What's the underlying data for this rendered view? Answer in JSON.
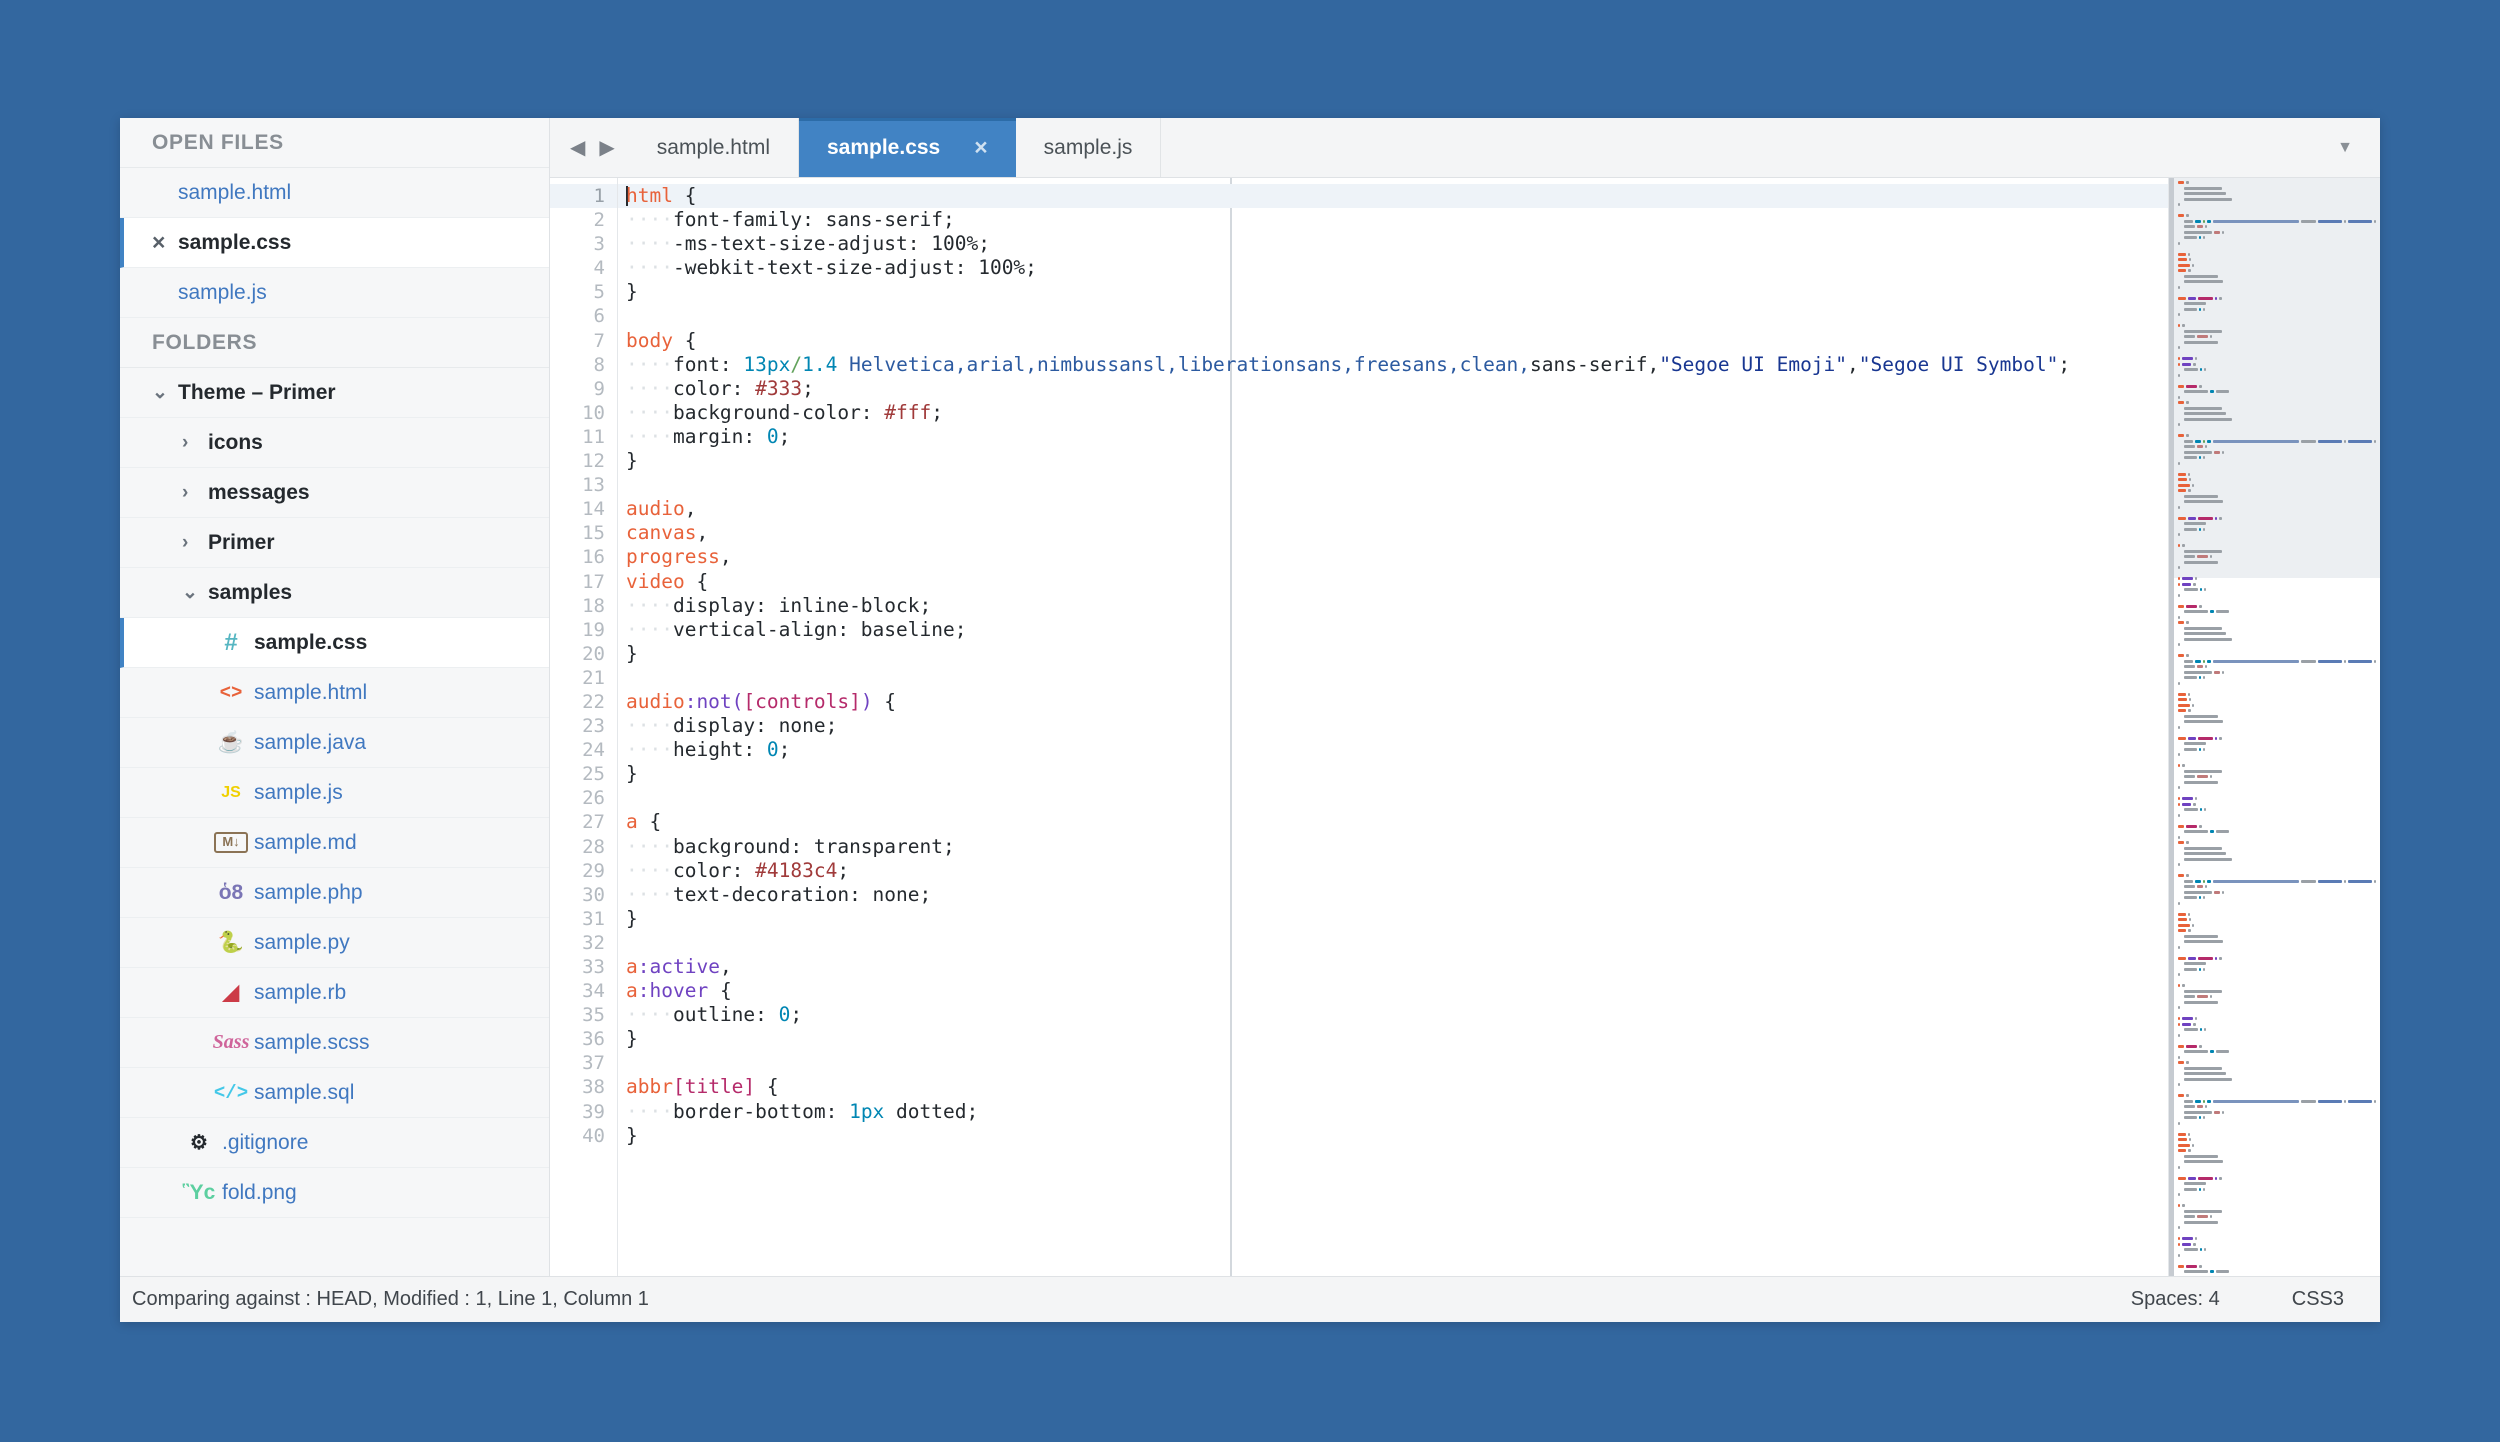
{
  "theme": {
    "desktop_bg": "#33679f",
    "accent": "#4183c4",
    "sidebar_bg": "#f6f7f8",
    "link": "#4078c0"
  },
  "sidebar": {
    "open_files_title": "OPEN FILES",
    "folders_title": "FOLDERS",
    "open_files": [
      {
        "label": "sample.html",
        "selected": false,
        "close_icon": ""
      },
      {
        "label": "sample.css",
        "selected": true,
        "close_icon": "×"
      },
      {
        "label": "sample.js",
        "selected": false,
        "close_icon": ""
      }
    ],
    "tree": [
      {
        "label": "Theme – Primer",
        "type": "folder",
        "twisty": "⌄",
        "expanded": true,
        "indent": 1,
        "icon": ""
      },
      {
        "label": "icons",
        "type": "folder",
        "twisty": "›",
        "expanded": false,
        "indent": 2,
        "icon": ""
      },
      {
        "label": "messages",
        "type": "folder",
        "twisty": "›",
        "expanded": false,
        "indent": 2,
        "icon": ""
      },
      {
        "label": "Primer",
        "type": "folder",
        "twisty": "›",
        "expanded": false,
        "indent": 2,
        "icon": ""
      },
      {
        "label": "samples",
        "type": "folder",
        "twisty": "⌄",
        "expanded": true,
        "indent": 2,
        "icon": ""
      },
      {
        "label": "sample.css",
        "type": "file",
        "indent": 3,
        "icon": "#",
        "icon_name": "css-file-icon",
        "selected": true
      },
      {
        "label": "sample.html",
        "type": "file",
        "indent": 3,
        "icon": "<>",
        "icon_name": "html-file-icon"
      },
      {
        "label": "sample.java",
        "type": "file",
        "indent": 3,
        "icon": "☕",
        "icon_name": "java-file-icon"
      },
      {
        "label": "sample.js",
        "type": "file",
        "indent": 3,
        "icon": "JS",
        "icon_name": "js-file-icon"
      },
      {
        "label": "sample.md",
        "type": "file",
        "indent": 3,
        "icon": "M↓",
        "icon_name": "markdown-file-icon"
      },
      {
        "label": "sample.php",
        "type": "file",
        "indent": 3,
        "icon": "ὁ8",
        "icon_name": "php-file-icon"
      },
      {
        "label": "sample.py",
        "type": "file",
        "indent": 3,
        "icon": "🐍",
        "icon_name": "python-file-icon"
      },
      {
        "label": "sample.rb",
        "type": "file",
        "indent": 3,
        "icon": "◢",
        "icon_name": "ruby-file-icon"
      },
      {
        "label": "sample.scss",
        "type": "file",
        "indent": 3,
        "icon": "Sass",
        "icon_name": "sass-file-icon"
      },
      {
        "label": "sample.sql",
        "type": "file",
        "indent": 3,
        "icon": "</>",
        "icon_name": "sql-file-icon"
      },
      {
        "label": ".gitignore",
        "type": "file",
        "indent": 2,
        "icon": "⚙",
        "icon_name": "gear-icon"
      },
      {
        "label": "fold.png",
        "type": "file",
        "indent": 2,
        "icon": "Ὓc",
        "icon_name": "image-file-icon"
      }
    ]
  },
  "tabbar": {
    "nav_back_icon": "◀",
    "nav_forward_icon": "▶",
    "menu_icon": "▼",
    "tabs": [
      {
        "label": "sample.html",
        "active": false,
        "close": ""
      },
      {
        "label": "sample.css",
        "active": true,
        "close": "×"
      },
      {
        "label": "sample.js",
        "active": false,
        "close": ""
      }
    ]
  },
  "editor": {
    "language": "CSS3",
    "first_line": 1,
    "total_visible_lines": 40,
    "lines": [
      {
        "n": 1,
        "tokens": [
          {
            "t": "caret",
            "v": ""
          },
          {
            "t": "sel",
            "v": "html"
          },
          {
            "t": "punc",
            "v": " {"
          }
        ]
      },
      {
        "n": 2,
        "tokens": [
          {
            "t": "ind",
            "v": "····"
          },
          {
            "t": "prop",
            "v": "font-family: sans-serif;"
          }
        ]
      },
      {
        "n": 3,
        "tokens": [
          {
            "t": "ind",
            "v": "····"
          },
          {
            "t": "prop",
            "v": "-ms-text-size-adjust: 100%;"
          }
        ]
      },
      {
        "n": 4,
        "tokens": [
          {
            "t": "ind",
            "v": "····"
          },
          {
            "t": "prop",
            "v": "-webkit-text-size-adjust: 100%;"
          }
        ]
      },
      {
        "n": 5,
        "tokens": [
          {
            "t": "punc",
            "v": "}"
          }
        ]
      },
      {
        "n": 6,
        "tokens": []
      },
      {
        "n": 7,
        "tokens": [
          {
            "t": "sel",
            "v": "body"
          },
          {
            "t": "punc",
            "v": " {"
          }
        ]
      },
      {
        "n": 8,
        "tokens": [
          {
            "t": "ind",
            "v": "····"
          },
          {
            "t": "prop",
            "v": "font: "
          },
          {
            "t": "num",
            "v": "13px"
          },
          {
            "t": "unit",
            "v": "/"
          },
          {
            "t": "num",
            "v": "1.4"
          },
          {
            "t": "font",
            "v": " Helvetica,arial,nimbussansl,liberationsans,freesans,clean,"
          },
          {
            "t": "prop",
            "v": "sans-serif,"
          },
          {
            "t": "str",
            "v": "\"Segoe UI Emoji\""
          },
          {
            "t": "punc",
            "v": ","
          },
          {
            "t": "str",
            "v": "\"Segoe UI Symbol\""
          },
          {
            "t": "punc",
            "v": ";"
          }
        ]
      },
      {
        "n": 9,
        "tokens": [
          {
            "t": "ind",
            "v": "····"
          },
          {
            "t": "prop",
            "v": "color: "
          },
          {
            "t": "color",
            "v": "#333"
          },
          {
            "t": "punc",
            "v": ";"
          }
        ]
      },
      {
        "n": 10,
        "tokens": [
          {
            "t": "ind",
            "v": "····"
          },
          {
            "t": "prop",
            "v": "background-color: "
          },
          {
            "t": "color",
            "v": "#fff"
          },
          {
            "t": "punc",
            "v": ";"
          }
        ]
      },
      {
        "n": 11,
        "tokens": [
          {
            "t": "ind",
            "v": "····"
          },
          {
            "t": "prop",
            "v": "margin: "
          },
          {
            "t": "num",
            "v": "0"
          },
          {
            "t": "punc",
            "v": ";"
          }
        ]
      },
      {
        "n": 12,
        "tokens": [
          {
            "t": "punc",
            "v": "}"
          }
        ]
      },
      {
        "n": 13,
        "tokens": []
      },
      {
        "n": 14,
        "tokens": [
          {
            "t": "sel",
            "v": "audio"
          },
          {
            "t": "punc",
            "v": ","
          }
        ]
      },
      {
        "n": 15,
        "tokens": [
          {
            "t": "sel",
            "v": "canvas"
          },
          {
            "t": "punc",
            "v": ","
          }
        ]
      },
      {
        "n": 16,
        "tokens": [
          {
            "t": "sel",
            "v": "progress"
          },
          {
            "t": "punc",
            "v": ","
          }
        ]
      },
      {
        "n": 17,
        "tokens": [
          {
            "t": "sel",
            "v": "video"
          },
          {
            "t": "punc",
            "v": " {"
          }
        ]
      },
      {
        "n": 18,
        "tokens": [
          {
            "t": "ind",
            "v": "····"
          },
          {
            "t": "prop",
            "v": "display: inline-block;"
          }
        ]
      },
      {
        "n": 19,
        "tokens": [
          {
            "t": "ind",
            "v": "····"
          },
          {
            "t": "prop",
            "v": "vertical-align: baseline;"
          }
        ]
      },
      {
        "n": 20,
        "tokens": [
          {
            "t": "punc",
            "v": "}"
          }
        ]
      },
      {
        "n": 21,
        "tokens": []
      },
      {
        "n": 22,
        "tokens": [
          {
            "t": "sel",
            "v": "audio"
          },
          {
            "t": "pseudo",
            "v": ":not("
          },
          {
            "t": "attr",
            "v": "[controls]"
          },
          {
            "t": "pseudo",
            "v": ")"
          },
          {
            "t": "punc",
            "v": " {"
          }
        ]
      },
      {
        "n": 23,
        "tokens": [
          {
            "t": "ind",
            "v": "····"
          },
          {
            "t": "prop",
            "v": "display: none;"
          }
        ]
      },
      {
        "n": 24,
        "tokens": [
          {
            "t": "ind",
            "v": "····"
          },
          {
            "t": "prop",
            "v": "height: "
          },
          {
            "t": "num",
            "v": "0"
          },
          {
            "t": "punc",
            "v": ";"
          }
        ]
      },
      {
        "n": 25,
        "tokens": [
          {
            "t": "punc",
            "v": "}"
          }
        ]
      },
      {
        "n": 26,
        "tokens": []
      },
      {
        "n": 27,
        "tokens": [
          {
            "t": "sel",
            "v": "a"
          },
          {
            "t": "punc",
            "v": " {"
          }
        ]
      },
      {
        "n": 28,
        "tokens": [
          {
            "t": "ind",
            "v": "····"
          },
          {
            "t": "prop",
            "v": "background: transparent;"
          }
        ]
      },
      {
        "n": 29,
        "tokens": [
          {
            "t": "ind",
            "v": "····"
          },
          {
            "t": "prop",
            "v": "color: "
          },
          {
            "t": "color",
            "v": "#4183c4"
          },
          {
            "t": "punc",
            "v": ";"
          }
        ]
      },
      {
        "n": 30,
        "tokens": [
          {
            "t": "ind",
            "v": "····"
          },
          {
            "t": "prop",
            "v": "text-decoration: none;"
          }
        ]
      },
      {
        "n": 31,
        "tokens": [
          {
            "t": "punc",
            "v": "}"
          }
        ]
      },
      {
        "n": 32,
        "tokens": []
      },
      {
        "n": 33,
        "tokens": [
          {
            "t": "sel",
            "v": "a"
          },
          {
            "t": "pseudo",
            "v": ":active"
          },
          {
            "t": "punc",
            "v": ","
          }
        ]
      },
      {
        "n": 34,
        "tokens": [
          {
            "t": "sel",
            "v": "a"
          },
          {
            "t": "pseudo",
            "v": ":hover"
          },
          {
            "t": "punc",
            "v": " {"
          }
        ]
      },
      {
        "n": 35,
        "tokens": [
          {
            "t": "ind",
            "v": "····"
          },
          {
            "t": "prop",
            "v": "outline: "
          },
          {
            "t": "num",
            "v": "0"
          },
          {
            "t": "punc",
            "v": ";"
          }
        ]
      },
      {
        "n": 36,
        "tokens": [
          {
            "t": "punc",
            "v": "}"
          }
        ]
      },
      {
        "n": 37,
        "tokens": []
      },
      {
        "n": 38,
        "tokens": [
          {
            "t": "sel",
            "v": "abbr"
          },
          {
            "t": "attr",
            "v": "[title]"
          },
          {
            "t": "punc",
            "v": " {"
          }
        ]
      },
      {
        "n": 39,
        "tokens": [
          {
            "t": "ind",
            "v": "····"
          },
          {
            "t": "prop",
            "v": "border-bottom: "
          },
          {
            "t": "num",
            "v": "1px"
          },
          {
            "t": "prop",
            "v": " dotted;"
          }
        ]
      },
      {
        "n": 40,
        "tokens": [
          {
            "t": "punc",
            "v": "}"
          }
        ]
      }
    ]
  },
  "statusbar": {
    "left_text": "Comparing against : HEAD, Modified : 1, Line 1, Column 1",
    "spaces": "Spaces: 4",
    "grammar": "CSS3"
  }
}
